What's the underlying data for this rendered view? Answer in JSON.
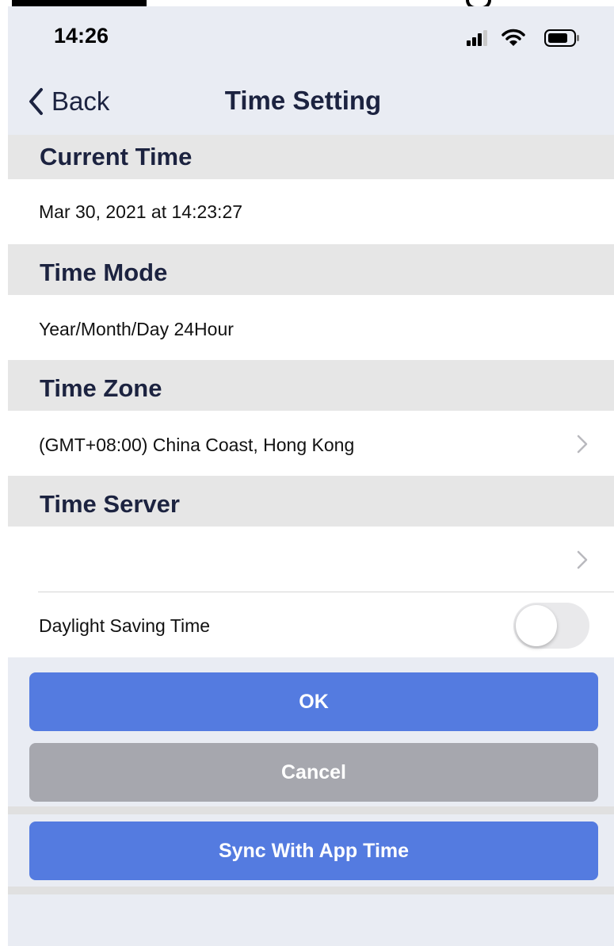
{
  "status_bar": {
    "time": "14:26"
  },
  "nav": {
    "back_label": "Back",
    "title": "Time Setting"
  },
  "sections": {
    "current_time": {
      "header": "Current Time",
      "value": "Mar 30, 2021 at 14:23:27"
    },
    "time_mode": {
      "header": "Time Mode",
      "value": "Year/Month/Day 24Hour"
    },
    "time_zone": {
      "header": "Time Zone",
      "value": "(GMT+08:00) China Coast, Hong Kong"
    },
    "time_server": {
      "header": "Time Server",
      "value": ""
    }
  },
  "daylight_saving": {
    "label": "Daylight Saving Time",
    "enabled": false
  },
  "buttons": {
    "ok": "OK",
    "cancel": "Cancel",
    "sync": "Sync With App Time"
  },
  "colors": {
    "accent": "#547be0",
    "secondary": "#a6a7ae",
    "nav_background": "#e9ecf3",
    "section_background": "#e6e6e6"
  },
  "icons": [
    "back-chevron-icon",
    "cellular-signal-icon",
    "wifi-icon",
    "battery-icon",
    "chevron-right-icon"
  ]
}
